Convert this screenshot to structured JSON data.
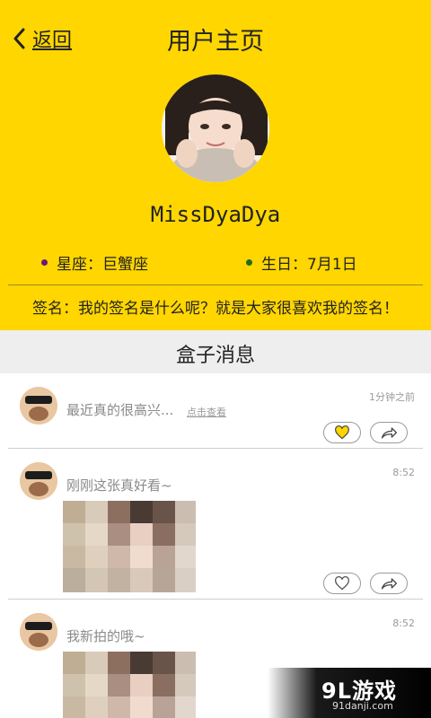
{
  "header": {
    "back_label": "返回",
    "title": "用户主页",
    "username": "MissDyaDya",
    "zodiac": "星座：巨蟹座",
    "birthday": "生日：7月1日",
    "signature": "签名：我的签名是什么呢？就是大家很喜欢我的签名！"
  },
  "section": {
    "title": "盒子消息"
  },
  "posts": [
    {
      "text": "最近真的很高兴...",
      "link": "点击查看",
      "time": "1分钟之前"
    },
    {
      "text": "刚刚这张真好看~",
      "time": "8:52"
    },
    {
      "text": "我新拍的哦~",
      "time": "8:52"
    }
  ],
  "watermark": {
    "logo": "9L游戏",
    "url": "91danji.com"
  },
  "colors": {
    "accent": "#FFD600",
    "zodiac_dot": "#6a1b6f",
    "birthday_dot": "#1f6b1f"
  }
}
